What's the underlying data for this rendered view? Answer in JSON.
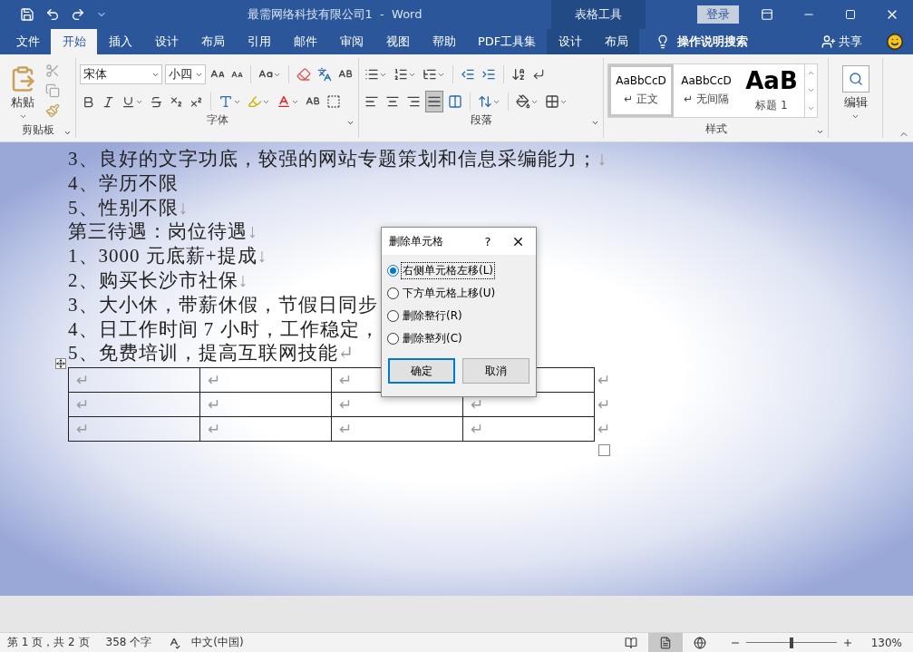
{
  "title_bar": {
    "title": "最需网络科技有限公司1  -  Word",
    "context_label": "表格工具",
    "sign_in": "登录"
  },
  "tabs": [
    {
      "label": "文件",
      "selected": false,
      "kind": "main"
    },
    {
      "label": "开始",
      "selected": true,
      "kind": "main"
    },
    {
      "label": "插入",
      "selected": false,
      "kind": "main"
    },
    {
      "label": "设计",
      "selected": false,
      "kind": "main"
    },
    {
      "label": "布局",
      "selected": false,
      "kind": "main"
    },
    {
      "label": "引用",
      "selected": false,
      "kind": "main"
    },
    {
      "label": "邮件",
      "selected": false,
      "kind": "main"
    },
    {
      "label": "审阅",
      "selected": false,
      "kind": "main"
    },
    {
      "label": "视图",
      "selected": false,
      "kind": "main"
    },
    {
      "label": "帮助",
      "selected": false,
      "kind": "main"
    },
    {
      "label": "PDF工具集",
      "selected": false,
      "kind": "main"
    },
    {
      "label": "设计",
      "selected": false,
      "kind": "context"
    },
    {
      "label": "布局",
      "selected": false,
      "kind": "context"
    }
  ],
  "tell_me": "操作说明搜索",
  "share": "共享",
  "ribbon": {
    "clipboard": {
      "paste": "粘贴",
      "label": "剪贴板"
    },
    "font": {
      "name": "宋体",
      "size": "小四",
      "label": "字体"
    },
    "paragraph": {
      "label": "段落"
    },
    "styles": {
      "label": "样式",
      "items": [
        {
          "preview": "AaBbCcD",
          "name": "正文",
          "mark": "↵",
          "selected": true,
          "kind": "body"
        },
        {
          "preview": "AaBbCcD",
          "name": "无间隔",
          "mark": "↵",
          "selected": false,
          "kind": "body"
        },
        {
          "preview": "AaB",
          "name": "标题 1",
          "selected": false,
          "kind": "heading"
        }
      ]
    },
    "editing": {
      "label": "编辑"
    }
  },
  "document": {
    "lines": [
      {
        "text": "3、良好的文字功底，较强的网站专题策划和信息采编能力；",
        "mark": "↓"
      },
      {
        "text": "4、学历不限"
      },
      {
        "text": "5、性别不限",
        "mark": "↓"
      },
      {
        "text": "第三待遇：岗位待遇",
        "mark": "↓"
      },
      {
        "text": "1、3000 元底薪+提成",
        "mark": "↓"
      },
      {
        "text": "2、购买长沙市社保",
        "mark": "↓"
      },
      {
        "text": "3、大小休，带薪休假，节假日同步"
      },
      {
        "text": "4、日工作时间 7 小时，工作稳定，"
      },
      {
        "text": "5、免费培训，提高互联网技能",
        "mark": "↵"
      }
    ],
    "table": {
      "rows": [
        {
          "cells": [
            "↵",
            "↵",
            "↵"
          ],
          "end_mark": "↵"
        },
        {
          "cells": [
            "↵",
            "↵",
            "↵",
            "↵"
          ],
          "end_mark": "↵"
        },
        {
          "cells": [
            "↵",
            "↵",
            "↵",
            "↵"
          ],
          "end_mark": "↵"
        }
      ]
    }
  },
  "dialog": {
    "title": "删除单元格",
    "help": "?",
    "options": [
      {
        "label": "右侧单元格左移(L)",
        "selected": true
      },
      {
        "label": "下方单元格上移(U)",
        "selected": false
      },
      {
        "label": "删除整行(R)",
        "selected": false
      },
      {
        "label": "删除整列(C)",
        "selected": false
      }
    ],
    "buttons": [
      {
        "label": "确定",
        "default": true
      },
      {
        "label": "取消",
        "default": false
      }
    ]
  },
  "status_bar": {
    "page": "第 1 页，共 2 页",
    "words": "358 个字",
    "language": "中文(中国)",
    "views": [
      {
        "kind": "read",
        "selected": false
      },
      {
        "kind": "print",
        "selected": true
      },
      {
        "kind": "web",
        "selected": false
      }
    ],
    "zoom": {
      "level": 0.5,
      "value": "130%"
    }
  }
}
